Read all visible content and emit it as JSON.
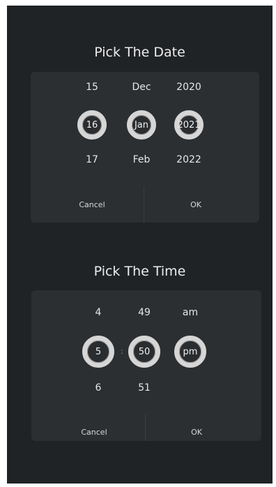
{
  "date_picker": {
    "title": "Pick The Date",
    "day": {
      "above": "15",
      "selected": "16",
      "below": "17"
    },
    "month": {
      "above": "Dec",
      "selected": "Jan",
      "below": "Feb"
    },
    "year": {
      "above": "2020",
      "selected": "2021",
      "below": "2022"
    },
    "cancel_label": "Cancel",
    "ok_label": "OK"
  },
  "time_picker": {
    "title": "Pick The Time",
    "hour": {
      "above": "4",
      "selected": "5",
      "below": "6"
    },
    "minute": {
      "above": "49",
      "selected": "50",
      "below": "51"
    },
    "ampm": {
      "above": "am",
      "selected": "pm",
      "below": ""
    },
    "separator": ":",
    "cancel_label": "Cancel",
    "ok_label": "OK"
  },
  "colors": {
    "background": "#202326",
    "card": "#2c2f32",
    "ring": "#d6d6d6",
    "text": "#ececec"
  }
}
